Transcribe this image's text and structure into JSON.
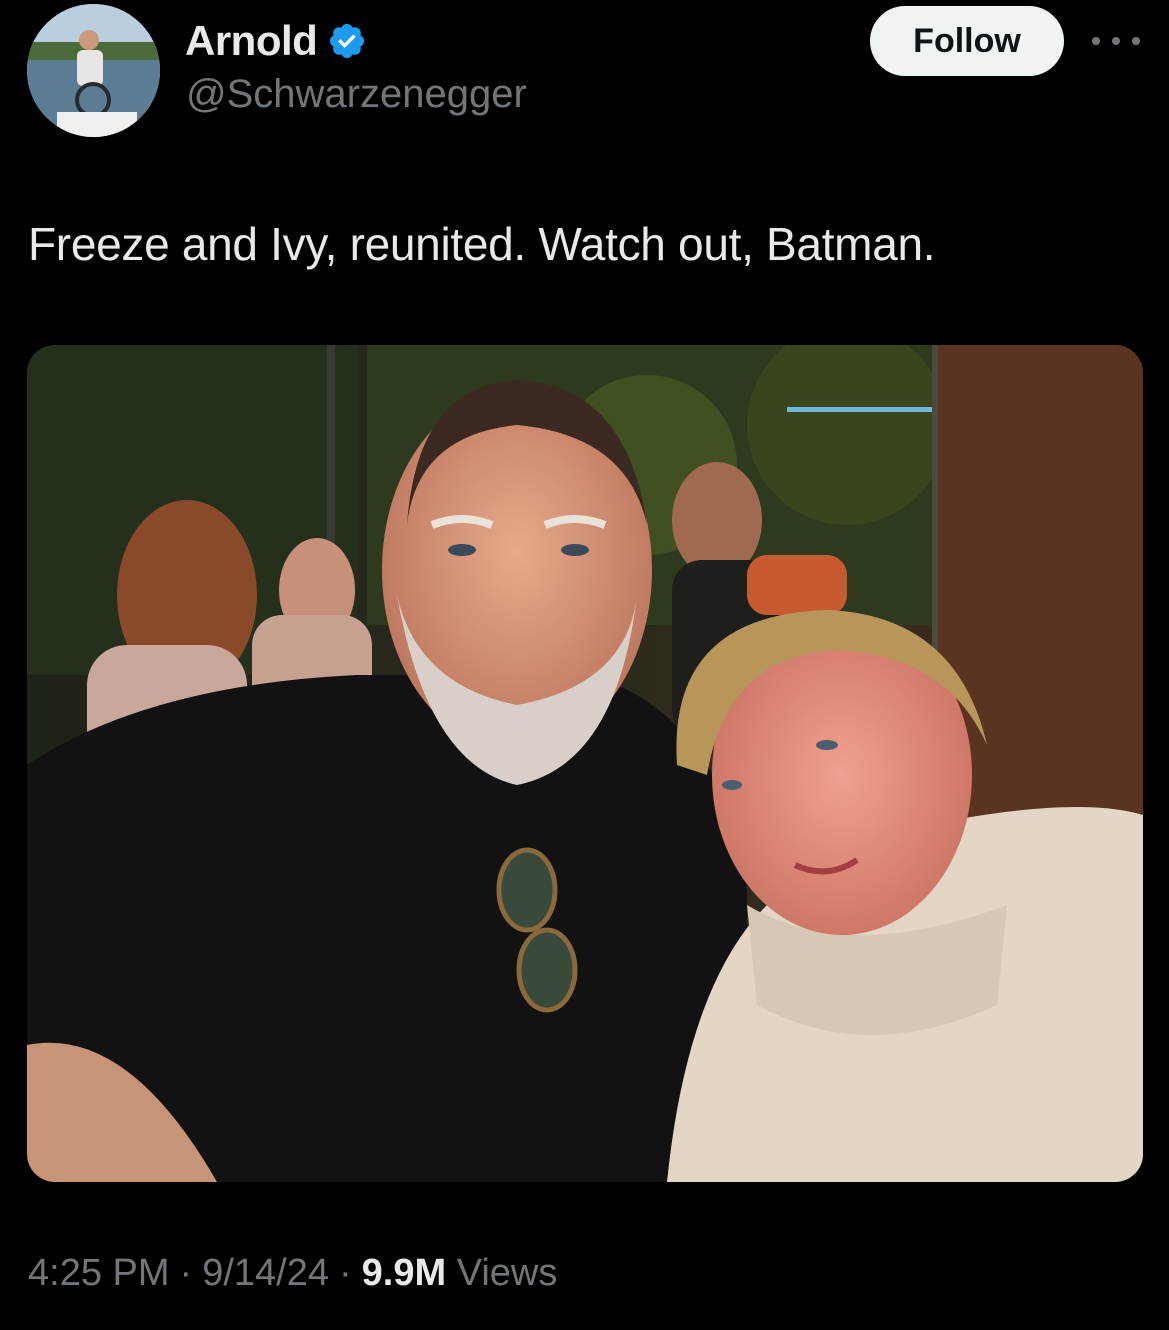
{
  "author": {
    "display_name": "Arnold",
    "handle": "@Schwarzenegger",
    "verified": true,
    "avatar_icon": "profile-photo"
  },
  "actions": {
    "follow_label": "Follow",
    "more_icon": "more-horizontal-icon"
  },
  "tweet": {
    "text": "Freeze and Ivy, reunited. Watch out, Batman.",
    "media_icon": "photo"
  },
  "meta": {
    "time": "4:25 PM",
    "separator": "·",
    "date": "9/14/24",
    "views_count": "9.9M",
    "views_label": "Views"
  },
  "colors": {
    "background": "#000000",
    "primary_text": "#e7e9ea",
    "secondary_text": "#71767b",
    "verified_blue": "#1d9bf0",
    "follow_bg": "#eff3f4",
    "follow_text": "#0f1419"
  }
}
